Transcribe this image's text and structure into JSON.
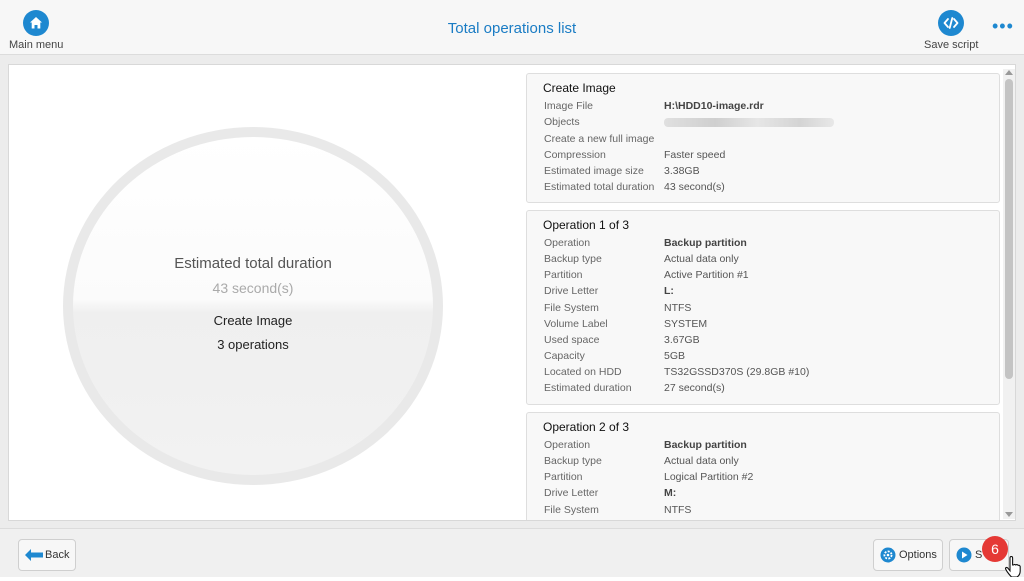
{
  "header": {
    "main_menu_label": "Main menu",
    "title": "Total operations list",
    "save_script_label": "Save script",
    "more_label": "•••"
  },
  "summary": {
    "duration_label": "Estimated total duration",
    "duration_value": "43 second(s)",
    "task_name": "Create Image",
    "operations_count": "3 operations"
  },
  "cards": {
    "create_image": {
      "title": "Create Image",
      "rows": [
        {
          "key": "Image File",
          "value": "H:\\HDD10-image.rdr"
        },
        {
          "key": "Objects",
          "value": ""
        },
        {
          "key": "Create a new full image",
          "value": ""
        },
        {
          "key": "Compression",
          "value": "Faster speed"
        },
        {
          "key": "Estimated image size",
          "value": "3.38GB"
        },
        {
          "key": "Estimated total duration",
          "value": "43 second(s)"
        }
      ]
    },
    "op1": {
      "title": "Operation 1 of 3",
      "rows": [
        {
          "key": "Operation",
          "value": "Backup partition"
        },
        {
          "key": "Backup type",
          "value": "Actual data only"
        },
        {
          "key": "Partition",
          "value": "Active Partition #1"
        },
        {
          "key": "Drive Letter",
          "value": "L:"
        },
        {
          "key": "File System",
          "value": "NTFS"
        },
        {
          "key": "Volume Label",
          "value": "SYSTEM"
        },
        {
          "key": "Used space",
          "value": "3.67GB"
        },
        {
          "key": "Capacity",
          "value": "5GB"
        },
        {
          "key": "Located on HDD",
          "value": "TS32GSSD370S (29.8GB #10)"
        },
        {
          "key": "Estimated duration",
          "value": "27 second(s)"
        }
      ]
    },
    "op2": {
      "title": "Operation 2 of 3",
      "rows": [
        {
          "key": "Operation",
          "value": "Backup partition"
        },
        {
          "key": "Backup type",
          "value": "Actual data only"
        },
        {
          "key": "Partition",
          "value": "Logical Partition #2"
        },
        {
          "key": "Drive Letter",
          "value": "M:"
        },
        {
          "key": "File System",
          "value": "NTFS"
        }
      ]
    }
  },
  "footer": {
    "back_label": "Back",
    "options_label": "Options",
    "start_label": "S",
    "step_badge": "6"
  },
  "colors": {
    "accent": "#1e88d0",
    "title": "#1a7cc4",
    "badge": "#e53935"
  }
}
